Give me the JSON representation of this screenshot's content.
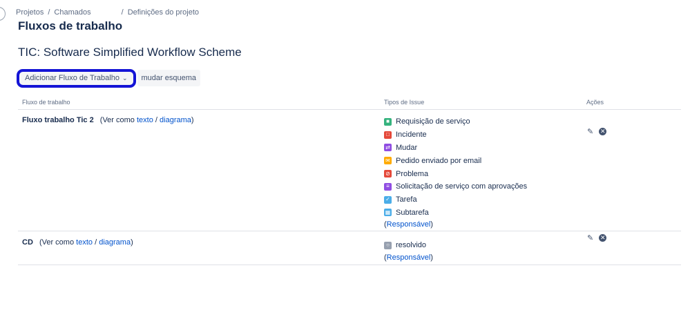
{
  "breadcrumb": {
    "items": [
      "Projetos",
      "Chamados",
      "Definições do projeto"
    ],
    "separator": "/"
  },
  "page_title": "Fluxos de trabalho",
  "scheme_title": "TIC: Software Simplified Workflow Scheme",
  "toolbar": {
    "add_workflow_label": "Adicionar Fluxo de Trabalho",
    "change_scheme_label": "mudar esquema"
  },
  "table": {
    "headers": {
      "workflow": "Fluxo de trabalho",
      "issue_types": "Tipos de Issue",
      "actions": "Ações"
    },
    "rows": [
      {
        "name": "Fluxo trabalho Tic 2",
        "view_prefix": "(Ver como",
        "text_link": "texto",
        "slash": "/",
        "diagram_link": "diagrama",
        "view_suffix": ")",
        "issue_types": [
          {
            "label": "Requisição de serviço",
            "icon": "service-request-icon",
            "color": "#36b37e"
          },
          {
            "label": "Incidente",
            "icon": "incident-icon",
            "color": "#e5493a"
          },
          {
            "label": "Mudar",
            "icon": "change-icon",
            "color": "#904ee2"
          },
          {
            "label": "Pedido enviado por email",
            "icon": "email-icon",
            "color": "#ffab00"
          },
          {
            "label": "Problema",
            "icon": "problem-icon",
            "color": "#e5493a"
          },
          {
            "label": "Solicitação de serviço com aprovações",
            "icon": "approval-request-icon",
            "color": "#904ee2"
          },
          {
            "label": "Tarefa",
            "icon": "task-icon",
            "color": "#4bade8"
          },
          {
            "label": "Subtarefa",
            "icon": "subtask-icon",
            "color": "#4bade8"
          }
        ],
        "responsible_prefix": "(",
        "responsible_link": "Responsável",
        "responsible_suffix": ")"
      },
      {
        "name": "CD",
        "view_prefix": "(Ver como",
        "text_link": "texto",
        "slash": "/",
        "diagram_link": "diagrama",
        "view_suffix": ")",
        "issue_types": [
          {
            "label": "resolvido",
            "icon": "resolved-icon",
            "color": "#97a0af"
          }
        ],
        "responsible_prefix": "(",
        "responsible_link": "Responsável",
        "responsible_suffix": ")"
      }
    ]
  },
  "icons": {
    "edit": "pencil-icon",
    "delete": "close-circle-icon",
    "dropdown": "chevron-down-icon"
  },
  "colors": {
    "highlight": "#1414d6",
    "link": "#0052cc"
  }
}
